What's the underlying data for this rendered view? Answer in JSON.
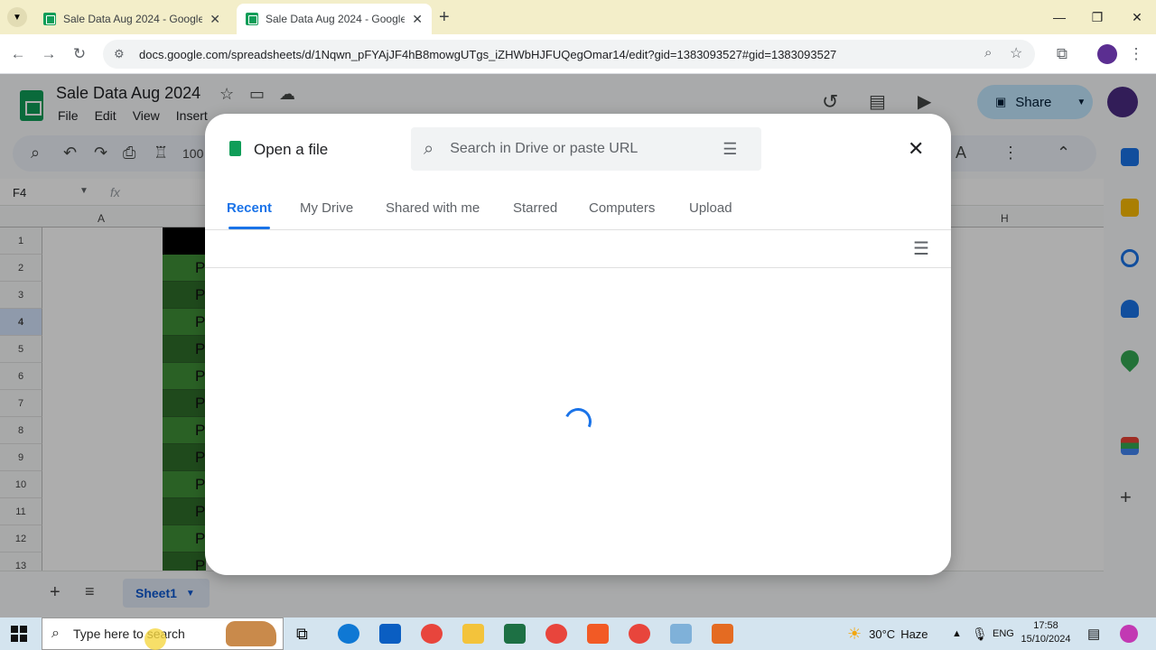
{
  "browser": {
    "tabs": [
      {
        "title": "Sale Data Aug 2024 - Google Sh",
        "active": false
      },
      {
        "title": "Sale Data Aug 2024 - Google Sh",
        "active": true
      }
    ],
    "new_tab": "+",
    "url": "docs.google.com/spreadsheets/d/1Nqwn_pFYAjJF4hB8mowgUTgs_iZHWbHJFUQegOmar14/edit?gid=1383093527#gid=1383093527",
    "window_controls": [
      "minimize",
      "maximize",
      "close"
    ]
  },
  "sheets": {
    "doc_title": "Sale Data Aug 2024",
    "menu": [
      "File",
      "Edit",
      "View",
      "Insert"
    ],
    "zoom": "100",
    "name_box": "F4",
    "fx": "fx",
    "share_label": "Share",
    "columns": [
      "A",
      "H"
    ],
    "row_numbers": [
      "1",
      "2",
      "3",
      "4",
      "5",
      "6",
      "7",
      "8",
      "9",
      "10",
      "11",
      "12",
      "13"
    ],
    "cell_letter": "P",
    "sheet_tab": "Sheet1",
    "accent": "#0f9d58"
  },
  "dialog": {
    "title": "Open a file",
    "search_placeholder": "Search in Drive or paste URL",
    "tabs": [
      "Recent",
      "My Drive",
      "Shared with me",
      "Starred",
      "Computers",
      "Upload"
    ],
    "active_tab": "Recent",
    "accent": "#1a73e8"
  },
  "taskbar": {
    "search_placeholder": "Type here to search",
    "weather_temp": "30°C",
    "weather_desc": "Haze",
    "lang": "ENG",
    "time": "17:58",
    "date": "15/10/2024"
  }
}
